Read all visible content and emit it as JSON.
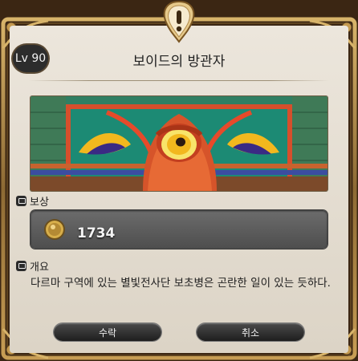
{
  "quest": {
    "level": "Lv 90",
    "title": "보이드의 방관자"
  },
  "reward": {
    "heading": "보상",
    "gil_amount": "1734",
    "coin_icon": "gil-coin-icon"
  },
  "summary": {
    "heading": "개요",
    "text": "다르마 구역에 있는 별빛전사단 보초병은 곤란한 일이 있는 듯하다."
  },
  "buttons": {
    "accept": "수락",
    "cancel": "취소"
  },
  "colors": {
    "frame_gold": "#b08a4a",
    "frame_dark": "#3b2613",
    "panel": "#e6e0d5",
    "button": "#2a2a2a"
  }
}
